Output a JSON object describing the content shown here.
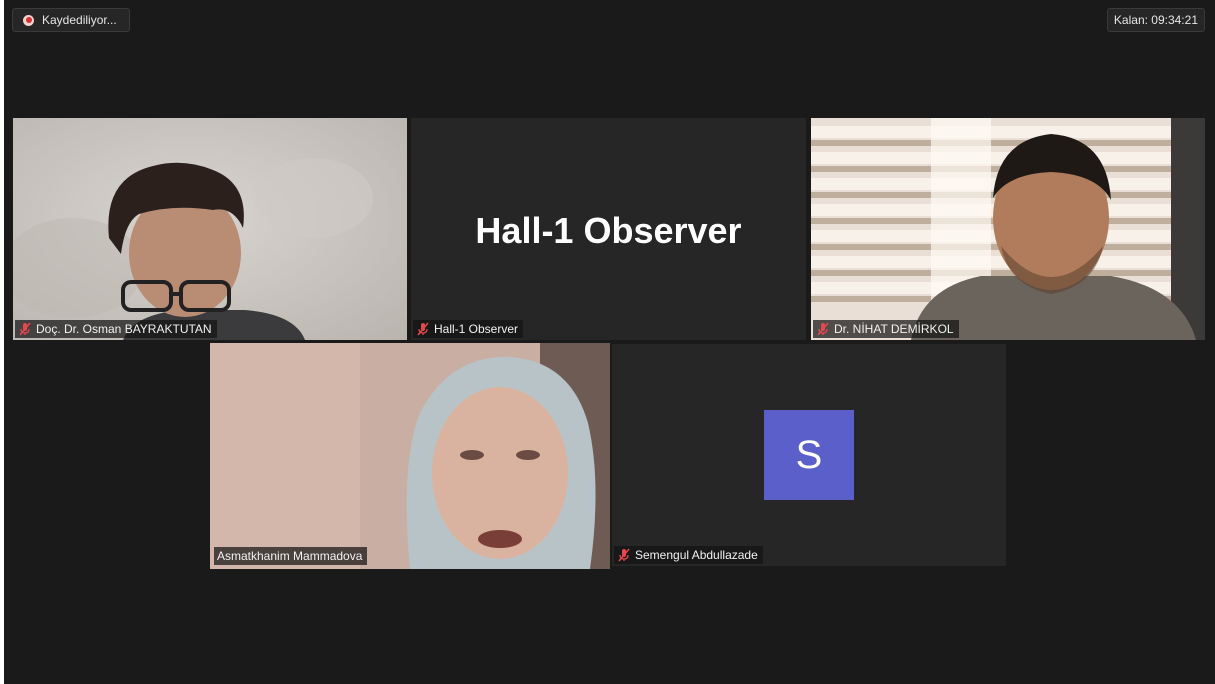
{
  "recording": {
    "label": "Kaydediliyor..."
  },
  "timer": {
    "label": "Kalan: 09:34:21"
  },
  "participants": [
    {
      "name": "Doç. Dr. Osman BAYRAKTUTAN",
      "muted": true
    },
    {
      "name": "Hall-1 Observer",
      "muted": true,
      "display_text": "Hall-1 Observer"
    },
    {
      "name": "Dr. NİHAT DEMİRKOL",
      "muted": true
    },
    {
      "name": "Asmatkhanim Mammadova",
      "muted": false,
      "speaking": true
    },
    {
      "name": "Semengul Abdullazade",
      "muted": true,
      "avatar_letter": "S"
    }
  ],
  "colors": {
    "active_speaker_border": "#cde26a",
    "avatar_bg": "#5a5fc9",
    "muted_icon": "#e5484d"
  },
  "icons": {
    "recording": "record-dot-icon",
    "muted": "mic-muted-icon"
  }
}
